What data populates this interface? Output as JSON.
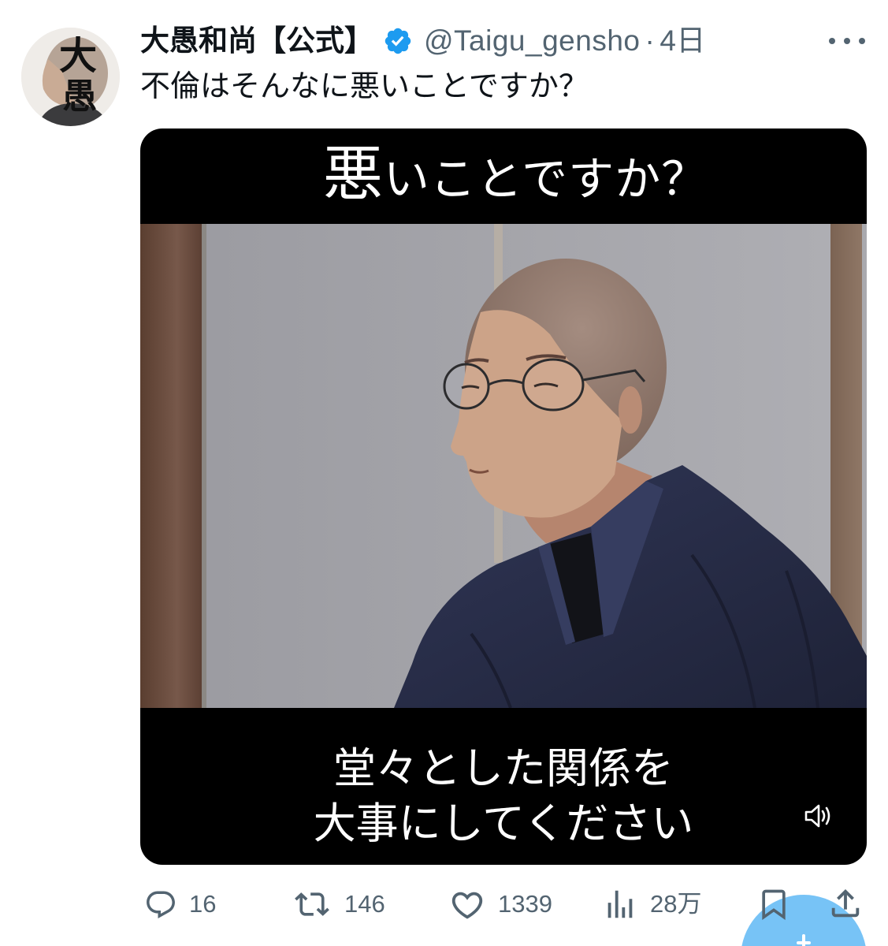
{
  "tweet": {
    "author": {
      "display_name": "大愚和尚【公式】",
      "handle": "@Taigu_gensho",
      "separator": "·",
      "timestamp": "4日",
      "verified": true,
      "verified_icon": "verified-badge-icon",
      "avatar": {
        "lettering": [
          "大",
          "愚"
        ]
      }
    },
    "more_icon": "more-icon",
    "text": "不倫はそんなに悪いことですか？",
    "media": {
      "type": "video",
      "caption_top": "悪いことですか？",
      "caption_bottom": [
        "堂々とした関係を",
        "大事にしてください"
      ],
      "volume_icon": "speaker-icon"
    },
    "actions": {
      "reply": {
        "icon": "reply-icon",
        "count": "16"
      },
      "retweet": {
        "icon": "retweet-icon",
        "count": "146"
      },
      "like": {
        "icon": "heart-icon",
        "count": "1339"
      },
      "views": {
        "icon": "views-icon",
        "count": "28万"
      },
      "bookmark": {
        "icon": "bookmark-icon"
      },
      "share": {
        "icon": "share-icon"
      }
    }
  },
  "compose_button": {
    "icon": "plus-icon"
  },
  "colors": {
    "text_primary": "#0f1419",
    "text_secondary": "#536471",
    "accent": "#1d9bf0",
    "media_background": "#000000",
    "caption_text": "#ffffff",
    "robe": "#2a2f4a"
  }
}
